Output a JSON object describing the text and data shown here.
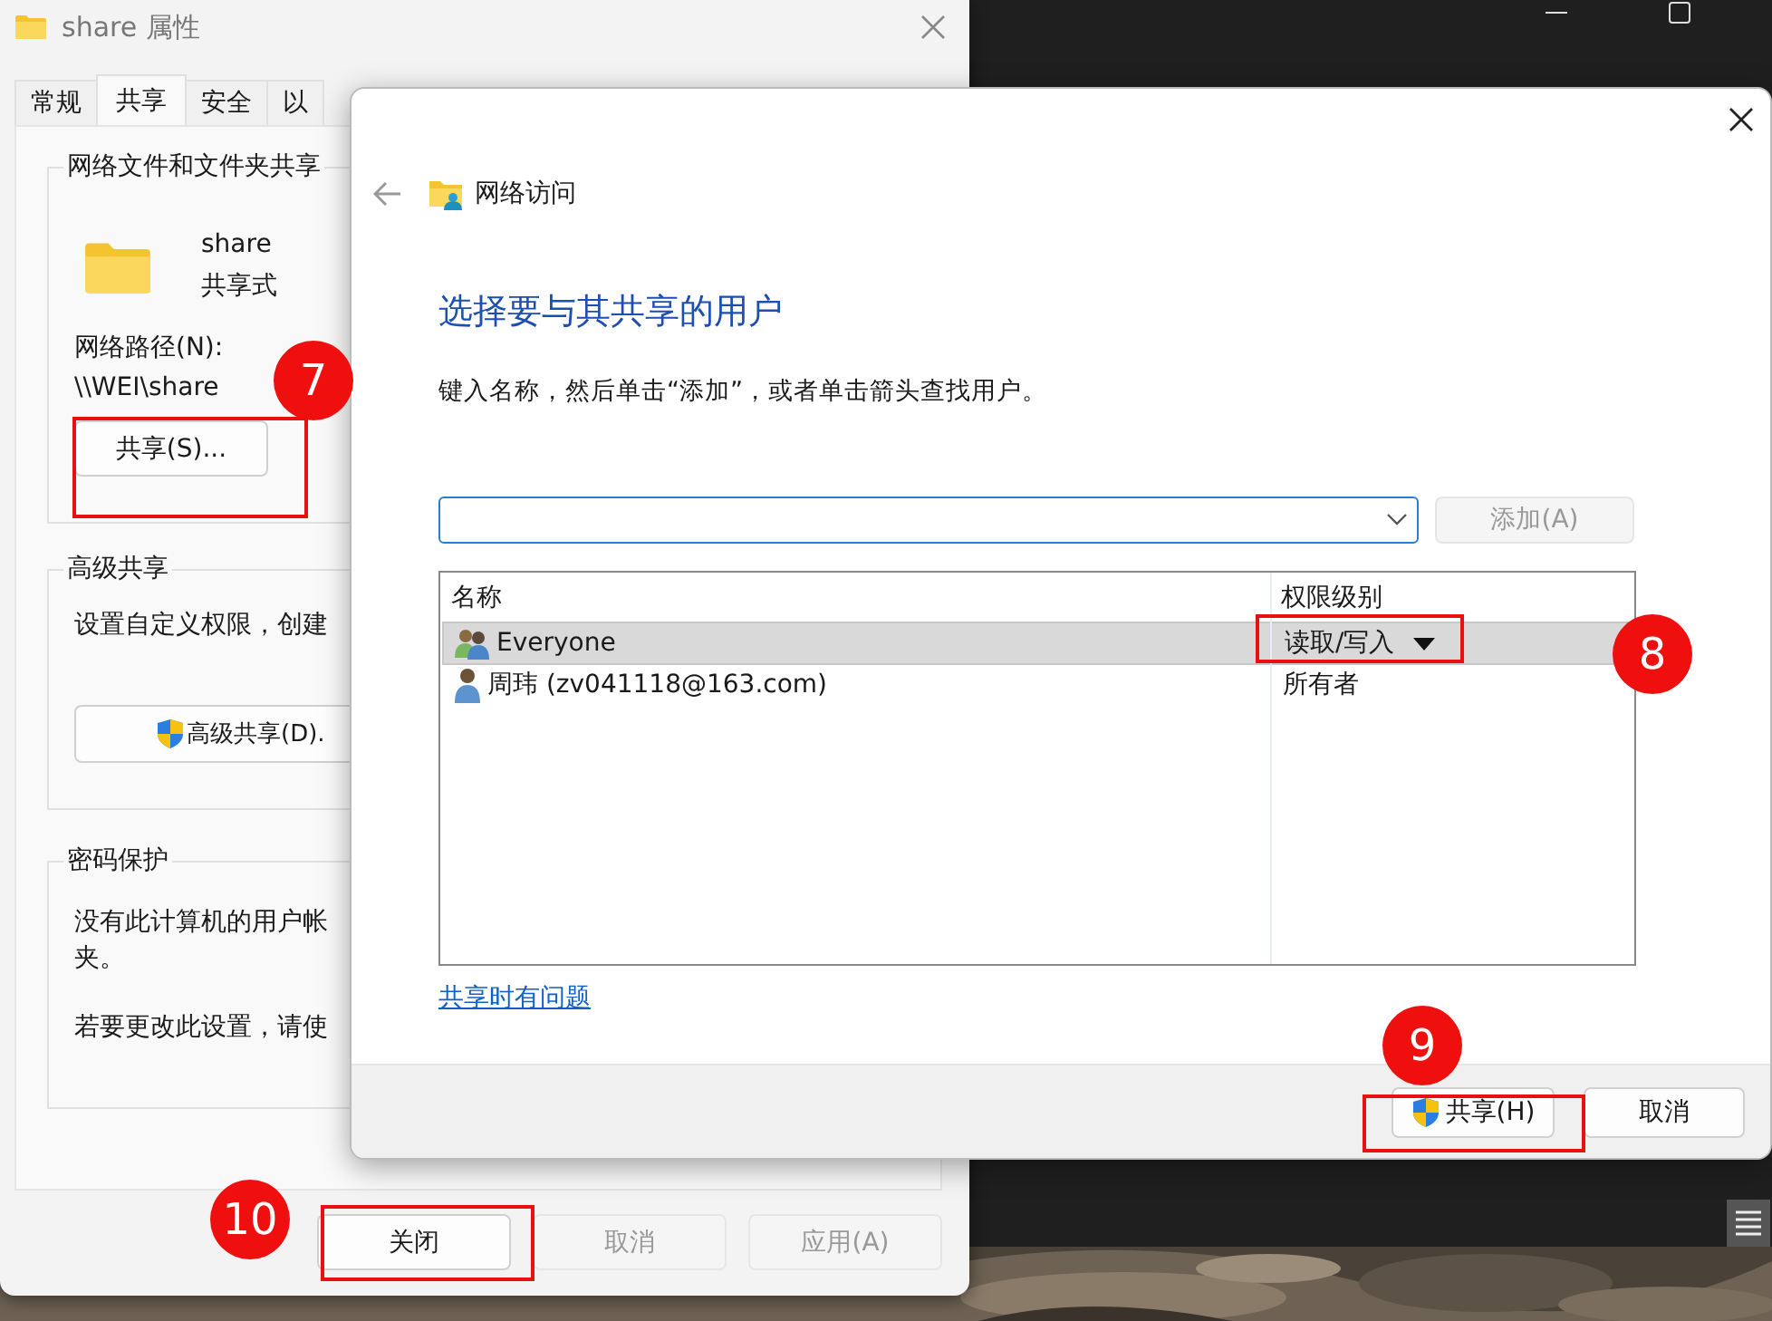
{
  "properties_window": {
    "title": "share 属性",
    "tabs": [
      {
        "label": "常规",
        "selected": false
      },
      {
        "label": "共享",
        "selected": true
      },
      {
        "label": "安全",
        "selected": false
      },
      {
        "label": "以",
        "selected": false
      }
    ],
    "network_sharing": {
      "heading": "网络文件和文件夹共享",
      "folder_name": "share",
      "folder_status": "共享式",
      "path_label": "网络路径(N):",
      "path": "\\\\WEI\\share",
      "share_button": "共享(S)..."
    },
    "advanced_sharing": {
      "heading": "高级共享",
      "description": "设置自定义权限，创建",
      "button": "高级共享(D)."
    },
    "password_protection": {
      "heading": "密码保护",
      "lines": [
        "没有此计算机的用户帐",
        "夹。"
      ],
      "note": "若要更改此设置，请使"
    },
    "buttons": [
      {
        "label": "关闭",
        "disabled": false
      },
      {
        "label": "取消",
        "disabled": true
      },
      {
        "label": "应用(A)",
        "disabled": true
      }
    ]
  },
  "dialog": {
    "title": "网络访问",
    "heading": "选择要与其共享的用户",
    "instruction": "键入名称，然后单击“添加”，或者单击箭头查找用户。",
    "add_button": {
      "label": "添加(A)",
      "disabled": true
    },
    "table": {
      "columns": [
        "名称",
        "权限级别"
      ],
      "rows": [
        {
          "kind": "group",
          "name": "Everyone",
          "permission": "读取/写入",
          "selected": true
        },
        {
          "kind": "user",
          "name": "周玮 (zv041118@163.com)",
          "permission": "所有者",
          "selected": false
        }
      ]
    },
    "help_link": "共享时有问题",
    "buttons": [
      {
        "label": "共享(H)",
        "shield": true
      },
      {
        "label": "取消",
        "shield": false
      }
    ]
  },
  "annotations": [
    {
      "label": "7"
    },
    {
      "label": "8"
    },
    {
      "label": "9"
    },
    {
      "label": "10"
    }
  ]
}
